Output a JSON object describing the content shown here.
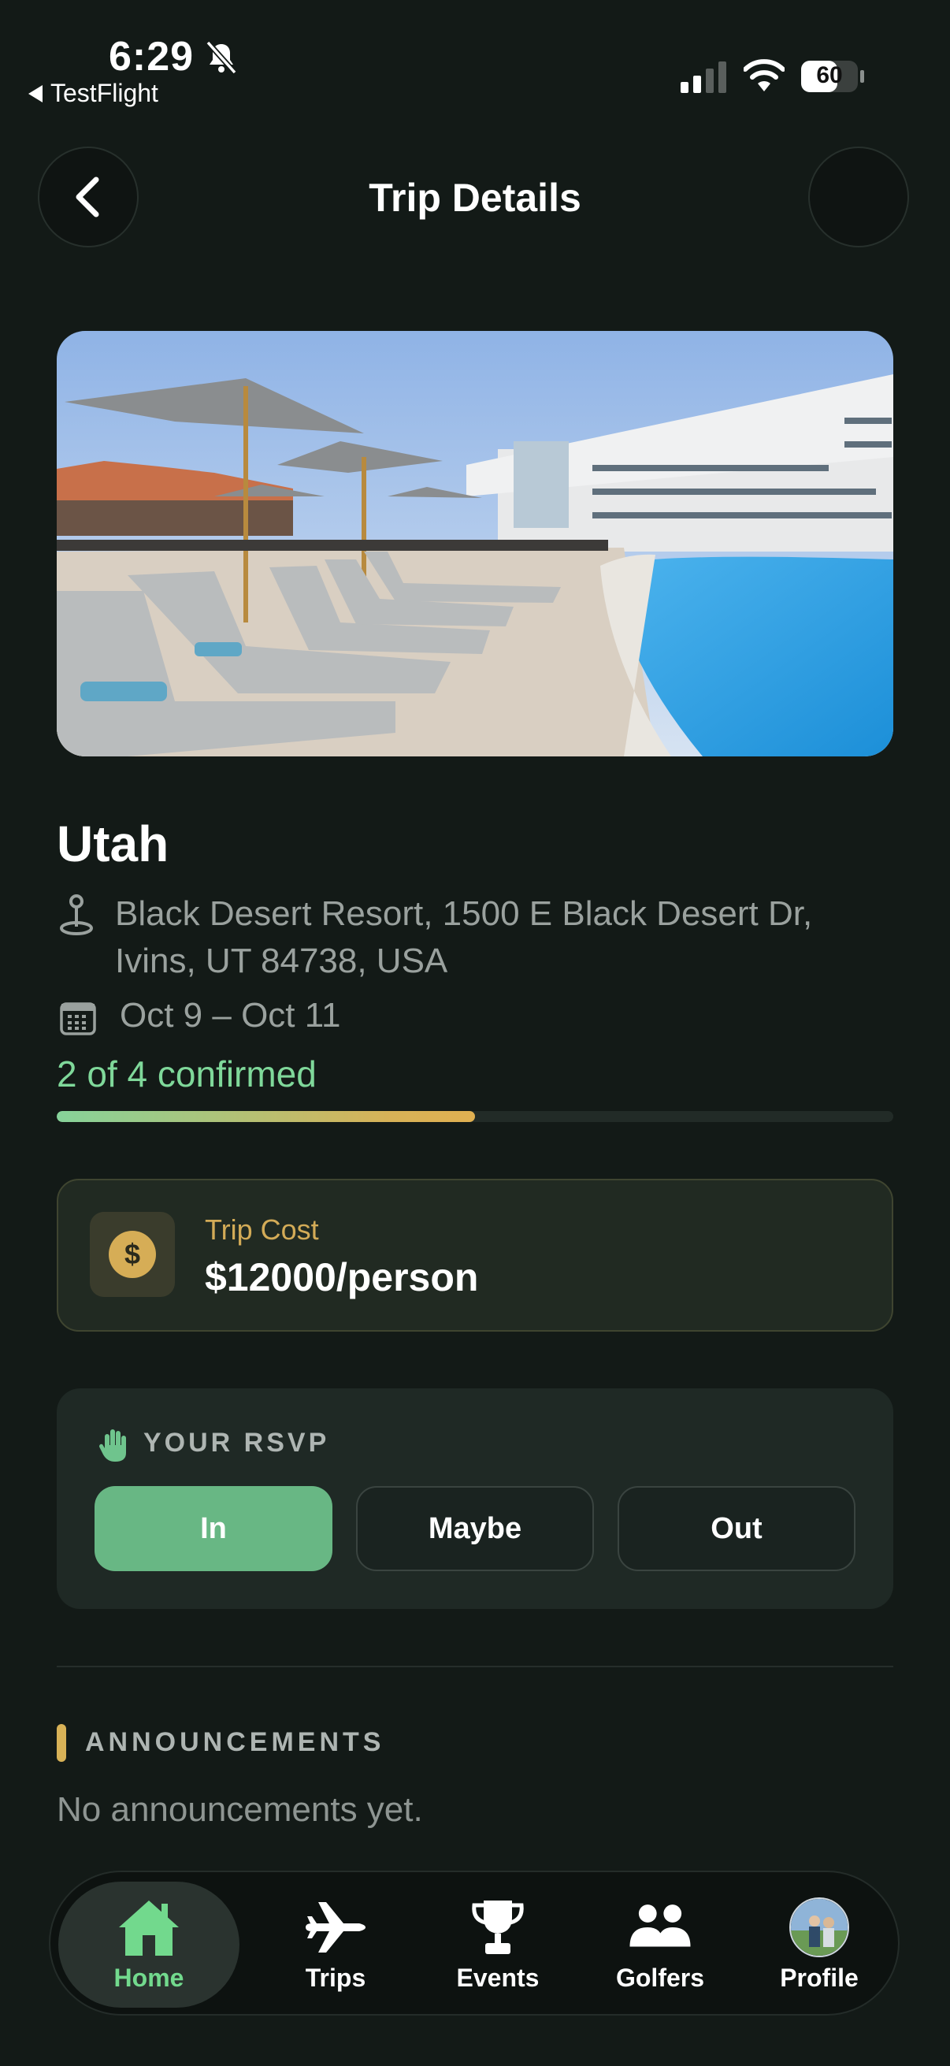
{
  "status_bar": {
    "time": "6:29",
    "back_app": "TestFlight",
    "battery": "60",
    "icons": [
      "bell-slash-icon",
      "cellular-signal-icon",
      "wifi-icon",
      "battery-icon"
    ]
  },
  "header": {
    "title": "Trip Details",
    "back_icon": "chevron-left-icon"
  },
  "trip": {
    "name": "Utah",
    "address": "Black Desert Resort, 1500 E Black Desert Dr, Ivins, UT 84738, USA",
    "dates": "Oct 9 – Oct 11",
    "confirmed_text": "2 of 4 confirmed",
    "confirmed_fraction": 0.5
  },
  "cost": {
    "label": "Trip Cost",
    "value": "$12000/person",
    "icon_symbol": "$"
  },
  "rsvp": {
    "label": "YOUR RSVP",
    "options": [
      "In",
      "Maybe",
      "Out"
    ],
    "selected": "In"
  },
  "announcements": {
    "label": "ANNOUNCEMENTS",
    "empty_text": "No announcements yet."
  },
  "tabbar": {
    "items": [
      {
        "label": "Home",
        "icon": "home-icon",
        "active": true
      },
      {
        "label": "Trips",
        "icon": "airplane-icon",
        "active": false
      },
      {
        "label": "Events",
        "icon": "trophy-icon",
        "active": false
      },
      {
        "label": "Golfers",
        "icon": "people-icon",
        "active": false
      },
      {
        "label": "Profile",
        "icon": "avatar",
        "active": false
      }
    ]
  },
  "colors": {
    "background": "#131a17",
    "accent_green": "#68b784",
    "confirmed_text": "#7fd89a",
    "gold": "#d8b257"
  }
}
